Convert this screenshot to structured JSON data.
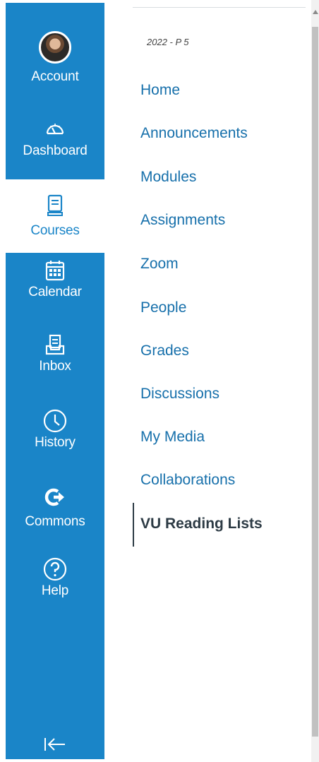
{
  "global_nav": {
    "account": "Account",
    "dashboard": "Dashboard",
    "courses": "Courses",
    "calendar": "Calendar",
    "inbox": "Inbox",
    "history": "History",
    "commons": "Commons",
    "help": "Help",
    "active": "Courses"
  },
  "course_nav": {
    "term": "2022 - P 5",
    "links": [
      "Home",
      "Announcements",
      "Modules",
      "Assignments",
      "Zoom",
      "People",
      "Grades",
      "Discussions",
      "My Media",
      "Collaborations",
      "VU Reading Lists"
    ],
    "active": "VU Reading Lists"
  },
  "colors": {
    "nav_bg": "#1a85c8",
    "link": "#1770ab",
    "active_text": "#2d3b45"
  }
}
